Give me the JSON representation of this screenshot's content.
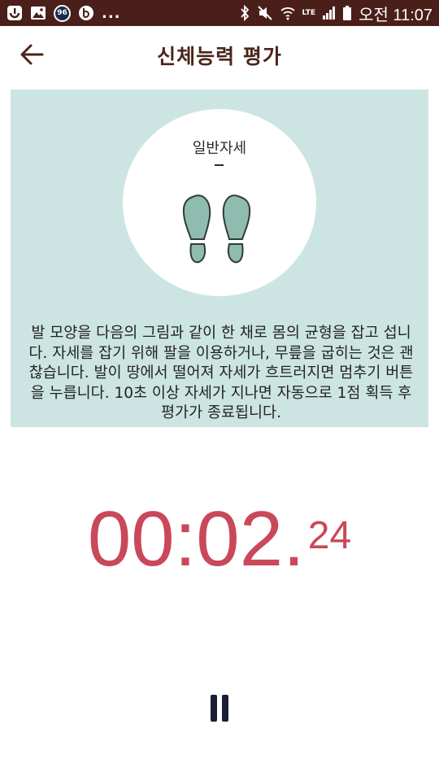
{
  "status_bar": {
    "notification_badge": "96",
    "more_indicator": "...",
    "network": "LTE",
    "time": "오전 11:07"
  },
  "header": {
    "title": "신체능력 평가"
  },
  "instruction": {
    "pose_label": "일반자세",
    "text": "발 모양을 다음의 그림과 같이 한 채로 몸의 균형을 잡고 섭니다. 자세를 잡기 위해 팔을 이용하거나, 무릎을 굽히는 것은 괜찮습니다. 발이 땅에서 떨어져 자세가 흐트러지면 멈추기 버튼을 누릅니다. 10초 이상 자세가 지나면 자동으로 1점 획득 후 평가가 종료됩니다."
  },
  "timer": {
    "main": "00:02.",
    "fraction": "24"
  },
  "colors": {
    "status_bar": "#4a1f1a",
    "title": "#4a2519",
    "panel": "#cce5e2",
    "footprint_fill": "#8fbcaf",
    "timer": "#c9485a",
    "pause": "#1a1f36"
  },
  "icons": {
    "back": "arrow-left-icon",
    "pause": "pause-icon",
    "pose": "footprints-icon"
  }
}
